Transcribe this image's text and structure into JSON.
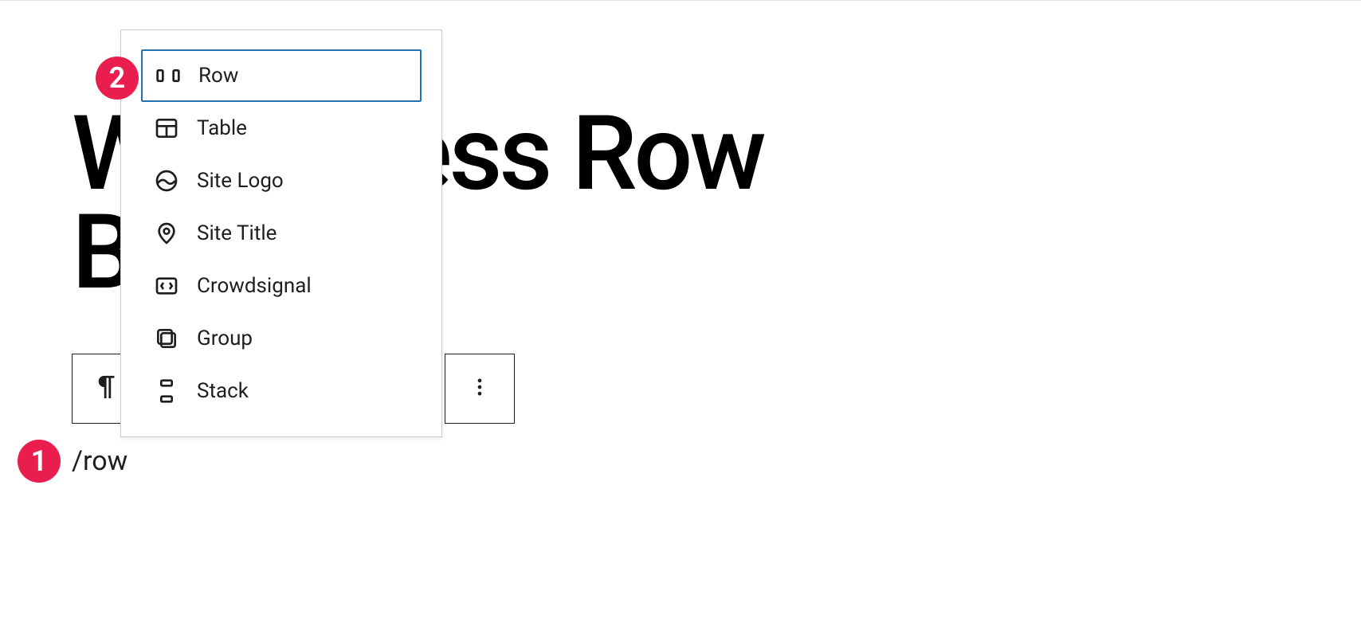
{
  "page": {
    "title_line1": "WordPress Row",
    "title_line2": "Block"
  },
  "editor": {
    "slash_command": "/row"
  },
  "block_suggestions": {
    "items": [
      {
        "label": "Row",
        "icon": "row-icon",
        "selected": true
      },
      {
        "label": "Table",
        "icon": "table-icon",
        "selected": false
      },
      {
        "label": "Site Logo",
        "icon": "site-logo-icon",
        "selected": false
      },
      {
        "label": "Site Title",
        "icon": "site-title-icon",
        "selected": false
      },
      {
        "label": "Crowdsignal",
        "icon": "crowdsignal-icon",
        "selected": false
      },
      {
        "label": "Group",
        "icon": "group-icon",
        "selected": false
      },
      {
        "label": "Stack",
        "icon": "stack-icon",
        "selected": false
      }
    ]
  },
  "annotations": {
    "badge1": "1",
    "badge2": "2"
  }
}
